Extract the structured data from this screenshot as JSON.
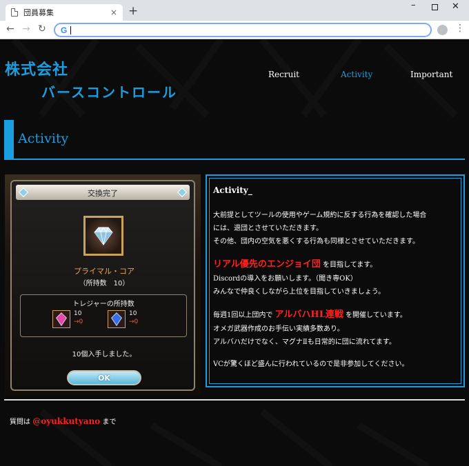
{
  "browser": {
    "tab_title": "団員募集",
    "tab_close": "×",
    "new_tab": "+",
    "win_min": "–",
    "win_close": "✕",
    "nav_back": "←",
    "nav_forward": "→",
    "nav_reload": "↻",
    "omnibox_logo": "G",
    "menu": "⋮"
  },
  "brand": {
    "line1": "株式会社",
    "line2": "バースコントロール",
    "color": "#1a9ee0"
  },
  "nav": {
    "recruit": "Recruit",
    "activity": "Activity",
    "important": "Important"
  },
  "section": {
    "title": "Activity"
  },
  "game": {
    "dialog_title": "交換完了",
    "item_name": "プライマル・コア",
    "item_held": "（所持数　10）",
    "treasure_title": "トレジャーの所持数",
    "treasures": [
      {
        "count": "10",
        "after": "→0"
      },
      {
        "count": "10",
        "after": "→0"
      }
    ],
    "obtained": "10個入手しました。",
    "ok_label": "OK"
  },
  "panel": {
    "title": "Activity_",
    "para1": [
      "大前提としてツールの使用やゲーム規約に反する行為を確認した場合",
      "には、退団とさせていただきます。",
      "その他、団内の空気を悪くする行為も同様とさせていただきます。"
    ],
    "para2_highlight": "リアル優先のエンジョイ団",
    "para2_rest": " を目指してます。",
    "para2_lines": [
      "Discordの導入をお願いします。（聞き専OK）",
      "みんなで仲良くしながら上位を目指していきましょう。"
    ],
    "para3_prefix": "毎週1回以上団内で ",
    "para3_highlight": "アルバハHL連戦",
    "para3_suffix": " を開催しています。",
    "para3_lines": [
      "オメガ武器作成のお手伝い実績多数あり。",
      "アルバハだけでなく、マグナⅡも日常的に団に流れてます。"
    ],
    "para4": "VCが驚くほど盛んに行われているので是非参加してください。"
  },
  "footer": {
    "prefix": "質問は ",
    "handle": "@oyukkutyano",
    "suffix": " まで"
  }
}
